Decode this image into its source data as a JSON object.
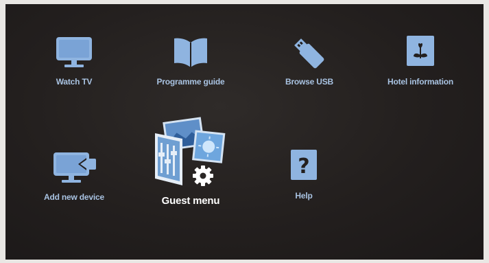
{
  "menu": {
    "items": [
      {
        "label": "Watch TV",
        "icon": "tv-icon"
      },
      {
        "label": "Programme guide",
        "icon": "book-icon"
      },
      {
        "label": "Browse USB",
        "icon": "usb-stick-icon"
      },
      {
        "label": "Hotel information",
        "icon": "hotel-info-icon"
      },
      {
        "label": "Add new device",
        "icon": "add-device-icon"
      },
      {
        "label": "Guest menu",
        "icon": "guest-menu-icon",
        "selected": true
      },
      {
        "label": "Help",
        "icon": "help-icon"
      }
    ]
  },
  "colors": {
    "background": "#231f1e",
    "icon": "#8fb4e0",
    "label": "#a9c3e2",
    "selected_label": "#ffffff"
  }
}
